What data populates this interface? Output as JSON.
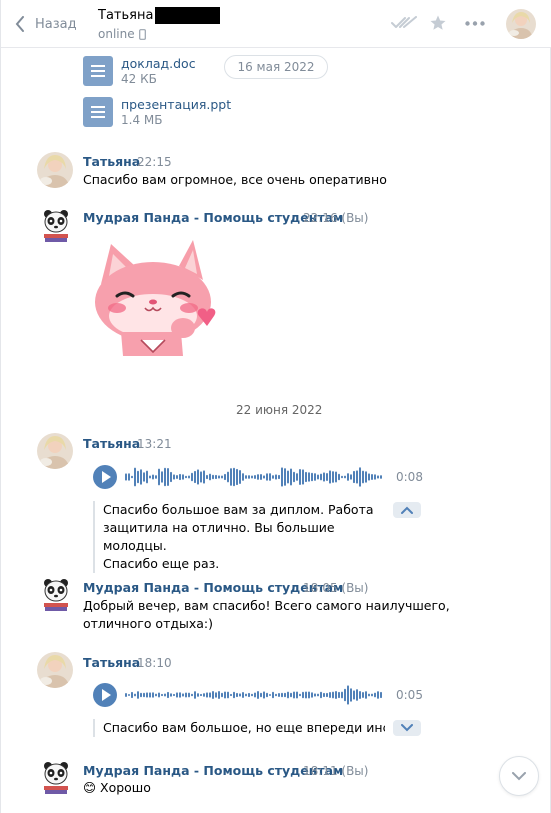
{
  "header": {
    "back_label": "Назад",
    "peer_name": "Татьяна",
    "peer_status": "online"
  },
  "documents": [
    {
      "name": "доклад.doc",
      "size": "42 КБ"
    },
    {
      "name": "презентация.ppt",
      "size": "1.4 МБ"
    }
  ],
  "date_pill": "16 мая 2022",
  "date_separator": "22 июня 2022",
  "messages": [
    {
      "author": "Татьяна",
      "time": "22:15",
      "text": "Спасибо вам огромное, все очень оперативно"
    },
    {
      "author": "Мудрая Панда - Помощь студентам",
      "time": "22:16 (Вы)"
    },
    {
      "author": "Татьяна",
      "time": "13:21",
      "duration": "0:08",
      "transcript": [
        "Спасибо большое вам за диплом. Работа",
        "защитила на отлично. Вы большие молодцы.",
        "Спасибо еще раз."
      ]
    },
    {
      "author": "Мудрая Панда - Помощь студентам",
      "time": "18:05 (Вы)",
      "text_lines": [
        "Добрый вечер, вам спасибо! Всего самого наилучшего,",
        "отличного отдыха:)"
      ]
    },
    {
      "author": "Татьяна",
      "time": "18:10",
      "duration": "0:05",
      "transcript": [
        "Спасибо вам большое, но еще впереди инстит"
      ]
    },
    {
      "author": "Мудрая Панда - Помощь студентам",
      "time": "18:11 (Вы)",
      "emoji": "😊",
      "text": "Хорошо"
    }
  ],
  "colors": {
    "link": "#2a5885",
    "accent": "#5181b8",
    "muted": "#818c99"
  },
  "icons": [
    "back-chevron-icon",
    "mobile-icon",
    "double-check-icon",
    "star-icon",
    "more-icon",
    "play-icon",
    "chevron-up-icon",
    "chevron-down-icon"
  ]
}
